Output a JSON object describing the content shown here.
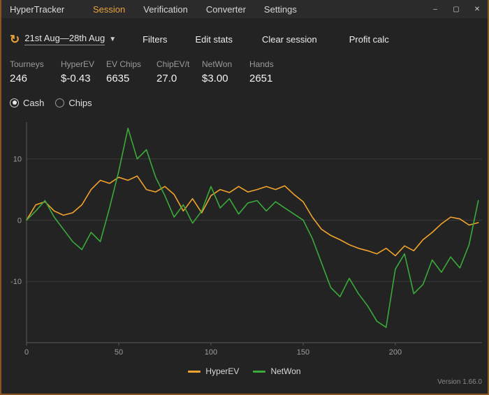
{
  "window": {
    "title": "HyperTracker",
    "controls": {
      "minimize": "–",
      "maximize": "▢",
      "close": "✕"
    }
  },
  "menu": {
    "items": [
      {
        "label": "Session",
        "active": true
      },
      {
        "label": "Verification",
        "active": false
      },
      {
        "label": "Converter",
        "active": false
      },
      {
        "label": "Settings",
        "active": false
      }
    ]
  },
  "toolbar": {
    "refresh_icon": "↻",
    "date_range": "21st Aug—28th Aug",
    "caret_icon": "▼",
    "buttons": [
      "Filters",
      "Edit stats",
      "Clear session",
      "Profit calc"
    ]
  },
  "stats": {
    "columns": [
      {
        "label": "Tourneys",
        "value": "246"
      },
      {
        "label": "HyperEV",
        "value": "$-0.43"
      },
      {
        "label": "EV Chips",
        "value": "6635"
      },
      {
        "label": "ChipEV/t",
        "value": "27.0"
      },
      {
        "label": "NetWon",
        "value": "$3.00"
      },
      {
        "label": "Hands",
        "value": "2651"
      }
    ]
  },
  "view_toggle": {
    "options": [
      {
        "label": "Cash",
        "selected": true
      },
      {
        "label": "Chips",
        "selected": false
      }
    ]
  },
  "chart_data": {
    "type": "line",
    "title": "",
    "xlabel": "",
    "ylabel": "",
    "xlim": [
      0,
      247
    ],
    "ylim": [
      -20,
      16
    ],
    "x_ticks": [
      0,
      50,
      100,
      150,
      200
    ],
    "y_ticks": [
      10,
      0,
      -10
    ],
    "grid": "horizontal",
    "legend_position": "bottom-center",
    "x": [
      0,
      5,
      10,
      15,
      20,
      25,
      30,
      35,
      40,
      45,
      50,
      55,
      60,
      65,
      70,
      75,
      80,
      85,
      90,
      95,
      100,
      105,
      110,
      115,
      120,
      125,
      130,
      135,
      140,
      145,
      150,
      155,
      160,
      165,
      170,
      175,
      180,
      185,
      190,
      195,
      200,
      205,
      210,
      215,
      220,
      225,
      230,
      235,
      240,
      245
    ],
    "series": [
      {
        "name": "HyperEV",
        "color": "#f2a32c",
        "values": [
          0,
          2.5,
          3,
          1.5,
          0.8,
          1.2,
          2.5,
          5,
          6.5,
          6,
          7,
          6.5,
          7.2,
          5,
          4.6,
          5.5,
          4.2,
          1.5,
          3.5,
          1.2,
          4,
          5,
          4.5,
          5.5,
          4.6,
          5,
          5.5,
          5,
          5.6,
          4.2,
          3,
          0.5,
          -1.5,
          -2.5,
          -3.2,
          -4,
          -4.6,
          -5,
          -5.5,
          -4.6,
          -5.8,
          -4.2,
          -5,
          -3.2,
          -2,
          -0.6,
          0.5,
          0.2,
          -0.8,
          -0.4
        ]
      },
      {
        "name": "NetWon",
        "color": "#3aaa3a",
        "values": [
          0,
          1.5,
          3.2,
          0.5,
          -1.5,
          -3.5,
          -4.8,
          -2,
          -3.5,
          2,
          8,
          15,
          10,
          11.5,
          7,
          4,
          0.5,
          2.5,
          -0.5,
          1.5,
          5.5,
          2,
          3.5,
          1,
          2.8,
          3.2,
          1.5,
          3,
          2,
          1,
          0,
          -3,
          -7,
          -11,
          -12.5,
          -9.5,
          -12,
          -14,
          -16.5,
          -17.5,
          -8,
          -5.5,
          -12,
          -10.5,
          -6.5,
          -8.5,
          -6,
          -7.8,
          -4,
          3.2
        ]
      }
    ]
  },
  "footer": {
    "version": "Version 1.66.0"
  },
  "colors": {
    "accent": "#e8a33d",
    "window_border": "#8a5520",
    "hyperev_line": "#f2a32c",
    "netwon_line": "#3aaa3a"
  }
}
